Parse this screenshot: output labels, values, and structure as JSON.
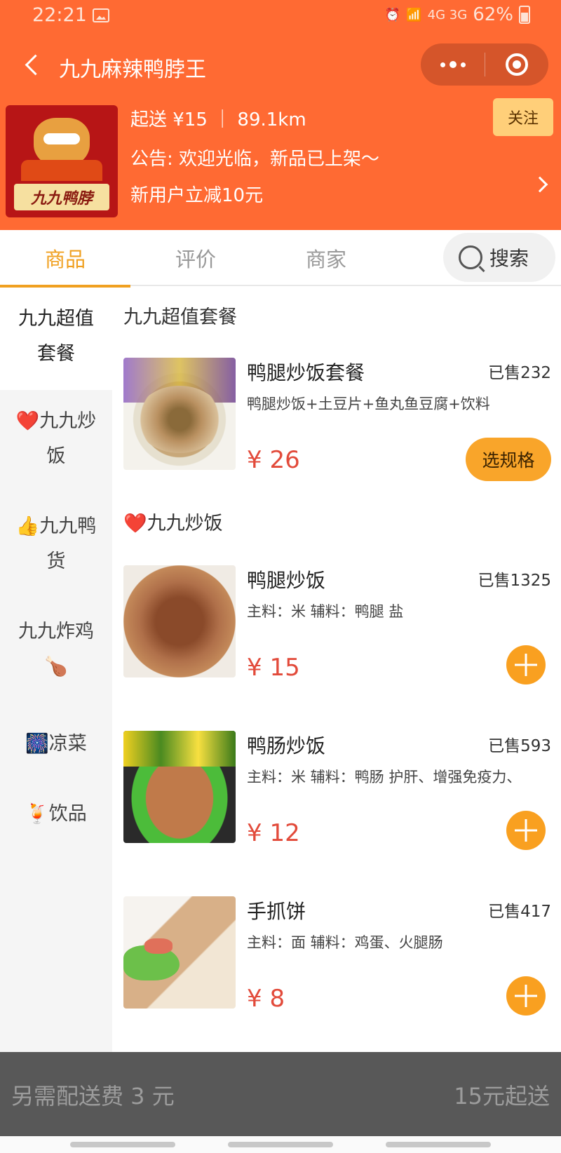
{
  "status": {
    "time": "22:21",
    "network": "4G 3G",
    "battery": "62%"
  },
  "nav": {
    "title": "九九麻辣鸭脖王"
  },
  "shop": {
    "logo_text": "九九鸭脖",
    "delivery": "起送 ¥15 ｜ 89.1km",
    "notice": "公告: 欢迎光临，新品已上架～",
    "promo": "新用户立减10元",
    "follow_label": "关注"
  },
  "tabs": [
    {
      "label": "商品",
      "active": true
    },
    {
      "label": "评价",
      "active": false
    },
    {
      "label": "商家",
      "active": false
    }
  ],
  "search": {
    "label": "搜索"
  },
  "categories": [
    {
      "label": "九九超值套餐",
      "active": true
    },
    {
      "label": "❤️九九炒饭",
      "active": false
    },
    {
      "label": "👍九九鸭货",
      "active": false
    },
    {
      "label": "九九炸鸡🍗",
      "active": false
    },
    {
      "label": "🎆凉菜",
      "active": false
    },
    {
      "label": "🍹饮品",
      "active": false
    }
  ],
  "sections": [
    {
      "title": "九九超值套餐",
      "items": [
        {
          "name": "鸭腿炒饭套餐",
          "sold": "已售232",
          "desc": "鸭腿炒饭+土豆片+鱼丸鱼豆腐+饮料",
          "price": "¥ 26",
          "action": "选规格"
        }
      ]
    },
    {
      "title": "❤️九九炒饭",
      "items": [
        {
          "name": "鸭腿炒饭",
          "sold": "已售1325",
          "desc": "主料：米 辅料：鸭腿 盐",
          "price": "¥ 15"
        },
        {
          "name": "鸭肠炒饭",
          "sold": "已售593",
          "desc": "主料：米 辅料：鸭肠 护肝、增强免疫力、",
          "price": "¥ 12"
        },
        {
          "name": "手抓饼",
          "sold": "已售417",
          "desc": "主料：面 辅料：鸡蛋、火腿肠",
          "price": "¥ 8"
        }
      ]
    }
  ],
  "bottom": {
    "delivery_fee": "另需配送费 3 元",
    "min_order": "15元起送"
  },
  "colors": {
    "header": "#ff6a33",
    "accent": "#f0a020",
    "price": "#e24a3a",
    "bottom_bar": "#585858"
  }
}
